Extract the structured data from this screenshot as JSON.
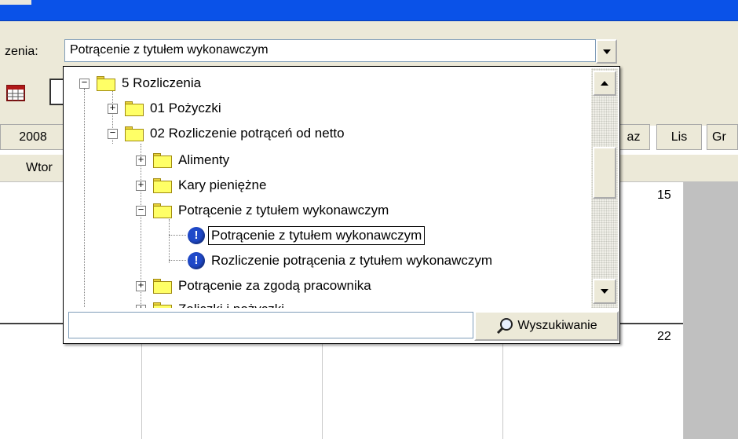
{
  "form": {
    "field_label": "zenia:",
    "combo_value": "Potrącenie z tytułem wykonawczym"
  },
  "calendar": {
    "year_label": "2008",
    "month_tabs": [
      "az",
      "Lis",
      "Gr"
    ],
    "day_name": "Wtor",
    "day_numbers": [
      "15",
      "22"
    ]
  },
  "tree": {
    "items": [
      {
        "label": "5 Rozliczenia",
        "type": "folder",
        "expander": "−"
      },
      {
        "label": "01 Pożyczki",
        "type": "folder",
        "expander": "+"
      },
      {
        "label": "02 Rozliczenie potrąceń od netto",
        "type": "folder",
        "expander": "−"
      },
      {
        "label": "Alimenty",
        "type": "folder",
        "expander": "+"
      },
      {
        "label": "Kary pieniężne",
        "type": "folder",
        "expander": "+"
      },
      {
        "label": "Potrącenie z tytułem wykonawczym",
        "type": "folder",
        "expander": "−"
      },
      {
        "label": "Potrącenie z tytułem wykonawczym",
        "type": "item",
        "selected": true
      },
      {
        "label": "Rozliczenie potrącenia z tytułem wykonawczym",
        "type": "item"
      },
      {
        "label": "Potrącenie za zgodą pracownika",
        "type": "folder",
        "expander": "+"
      },
      {
        "label": "Zaliczki i pożyczki",
        "type": "folder",
        "expander": "+"
      }
    ]
  },
  "search": {
    "value": "",
    "button_label": "Wyszukiwanie"
  },
  "icons": {
    "folder": "folder-icon",
    "item": "info-icon",
    "search": "magnifier-icon"
  },
  "colors": {
    "titlebar": "#0a52e8",
    "folder": "#ffff66",
    "info_badge": "#1f49c9",
    "panel": "#ece9d8"
  }
}
